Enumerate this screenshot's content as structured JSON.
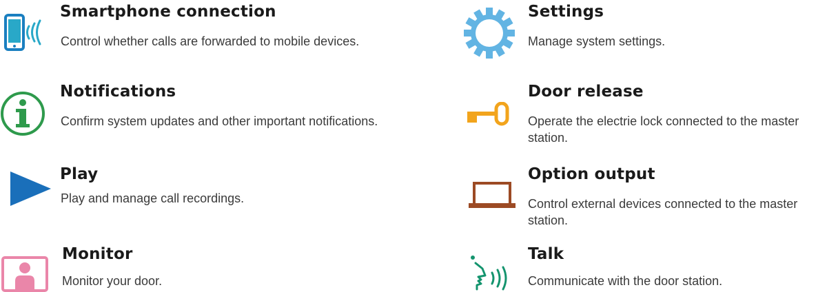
{
  "colors": {
    "blue": "#1a7fc0",
    "cyan": "#29a8c8",
    "green": "#2e9a4c",
    "gear": "#62b4e3",
    "orange": "#f2a41c",
    "brown": "#9c4a24",
    "pink": "#ea86a9",
    "talk_green": "#14946e"
  },
  "features": [
    {
      "icon": "smartphone-connection-icon",
      "title": "Smartphone connection",
      "desc": "Control whether calls are forwarded to mobile devices."
    },
    {
      "icon": "notifications-info-icon",
      "title": "Notifications",
      "desc": "Confirm system updates and other important notifications."
    },
    {
      "icon": "play-icon",
      "title": "Play",
      "desc": "Play and manage call recordings."
    },
    {
      "icon": "monitor-icon",
      "title": "Monitor",
      "desc": "Monitor your door."
    },
    {
      "icon": "gear-icon",
      "title": "Settings",
      "desc": "Manage system settings."
    },
    {
      "icon": "key-icon",
      "title": "Door release",
      "desc": "Operate the electrie lock connected to the master station."
    },
    {
      "icon": "option-output-icon",
      "title": "Option output",
      "desc": "Control external devices connected to the master station."
    },
    {
      "icon": "talk-icon",
      "title": "Talk",
      "desc": "Communicate with the door station."
    }
  ]
}
